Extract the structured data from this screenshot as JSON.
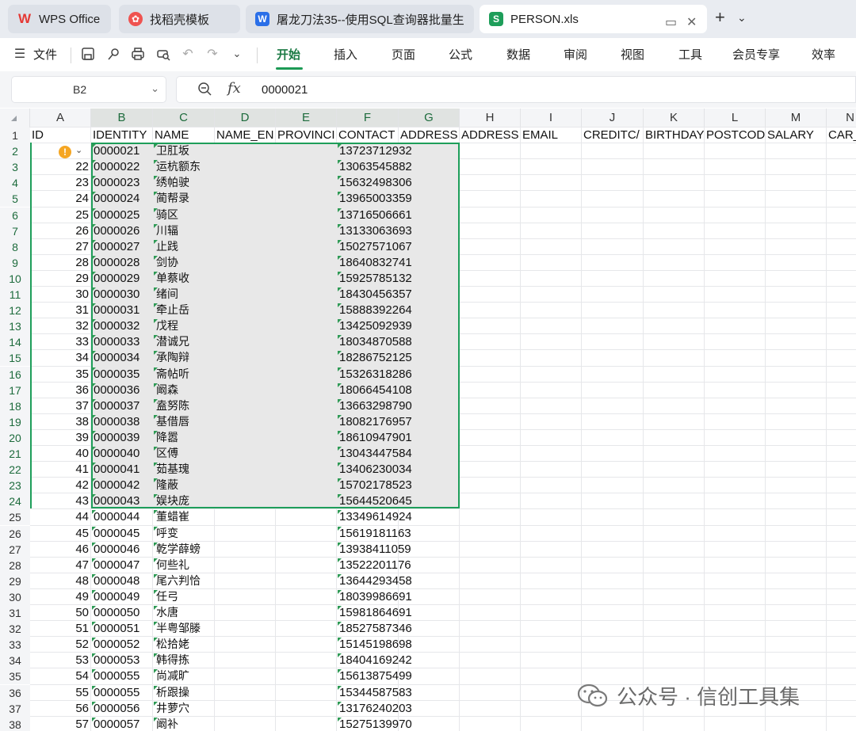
{
  "tabs": [
    {
      "title": "WPS Office",
      "icon": "wps-logo-icon",
      "icon_glyph": "W",
      "color": "#e53935"
    },
    {
      "title": "找稻壳模板",
      "icon": "docer-icon",
      "icon_glyph": "♨",
      "color": "#ef5350"
    },
    {
      "title": "屠龙刀法35--使用SQL查询器批量生",
      "icon": "word-doc-icon",
      "icon_glyph": "W",
      "color": "#2b6fe8"
    },
    {
      "title": "PERSON.xls",
      "icon": "spreadsheet-icon",
      "icon_glyph": "S",
      "color": "#1e9e5a"
    }
  ],
  "ribbon": {
    "file_menu": "文件",
    "menus": [
      "开始",
      "插入",
      "页面",
      "公式",
      "数据",
      "审阅",
      "视图",
      "工具",
      "会员专享",
      "效率"
    ],
    "active_menu": "开始",
    "quick_icons": [
      "save-icon",
      "format-painter-icon",
      "print-icon",
      "print-preview-icon",
      "undo-icon",
      "redo-icon",
      "more-dropdown-icon"
    ]
  },
  "formula_bar": {
    "name_box": "B2",
    "fx_label": "fx",
    "value": "0000021"
  },
  "columns": [
    "A",
    "B",
    "C",
    "D",
    "E",
    "F",
    "G",
    "H",
    "I",
    "J",
    "K",
    "L",
    "M",
    "N"
  ],
  "selected_columns": [
    "B",
    "C",
    "D",
    "E",
    "F",
    "G"
  ],
  "header_row": [
    "ID",
    "IDENTITY",
    "NAME",
    "NAME_EN",
    "PROVINCI",
    "CONTACT",
    "ADDRESS",
    "ADDRESS",
    "EMAIL",
    "CREDITC/",
    "BIRTHDAY",
    "POSTCOD",
    "SALARY",
    "CAR_"
  ],
  "rows": [
    {
      "row": "2",
      "id": "",
      "identity": "0000021",
      "name": "卫肛坂",
      "contact": "13723712932"
    },
    {
      "row": "3",
      "id": "22",
      "identity": "0000022",
      "name": "运杭额东",
      "contact": "13063545882"
    },
    {
      "row": "4",
      "id": "23",
      "identity": "0000023",
      "name": "绣帕驶",
      "contact": "15632498306"
    },
    {
      "row": "5",
      "id": "24",
      "identity": "0000024",
      "name": "蔺帮录",
      "contact": "13965003359"
    },
    {
      "row": "6",
      "id": "25",
      "identity": "0000025",
      "name": "骑区",
      "contact": "13716506661"
    },
    {
      "row": "7",
      "id": "26",
      "identity": "0000026",
      "name": "川辐",
      "contact": "13133063693"
    },
    {
      "row": "8",
      "id": "27",
      "identity": "0000027",
      "name": "止践",
      "contact": "15027571067"
    },
    {
      "row": "9",
      "id": "28",
      "identity": "0000028",
      "name": "剑协",
      "contact": "18640832741"
    },
    {
      "row": "10",
      "id": "29",
      "identity": "0000029",
      "name": "单蔡收",
      "contact": "15925785132"
    },
    {
      "row": "11",
      "id": "30",
      "identity": "0000030",
      "name": "绪间",
      "contact": "18430456357"
    },
    {
      "row": "12",
      "id": "31",
      "identity": "0000031",
      "name": "牵止岳",
      "contact": "15888392264"
    },
    {
      "row": "13",
      "id": "32",
      "identity": "0000032",
      "name": "戊程",
      "contact": "13425092939"
    },
    {
      "row": "14",
      "id": "33",
      "identity": "0000033",
      "name": "潜诚兄",
      "contact": "18034870588"
    },
    {
      "row": "15",
      "id": "34",
      "identity": "0000034",
      "name": "承陶辩",
      "contact": "18286752125"
    },
    {
      "row": "16",
      "id": "35",
      "identity": "0000035",
      "name": "斋帖听",
      "contact": "15326318286"
    },
    {
      "row": "17",
      "id": "36",
      "identity": "0000036",
      "name": "阚森",
      "contact": "18066454108"
    },
    {
      "row": "18",
      "id": "37",
      "identity": "0000037",
      "name": "盍努陈",
      "contact": "13663298790"
    },
    {
      "row": "19",
      "id": "38",
      "identity": "0000038",
      "name": "基借唇",
      "contact": "18082176957"
    },
    {
      "row": "20",
      "id": "39",
      "identity": "0000039",
      "name": "降嚣",
      "contact": "18610947901"
    },
    {
      "row": "21",
      "id": "40",
      "identity": "0000040",
      "name": "区傅",
      "contact": "13043447584"
    },
    {
      "row": "22",
      "id": "41",
      "identity": "0000041",
      "name": "茹基瑰",
      "contact": "13406230034"
    },
    {
      "row": "23",
      "id": "42",
      "identity": "0000042",
      "name": "隆蔽",
      "contact": "15702178523"
    },
    {
      "row": "24",
      "id": "43",
      "identity": "0000043",
      "name": "娱块庞",
      "contact": "15644520645"
    },
    {
      "row": "25",
      "id": "44",
      "identity": "0000044",
      "name": "董蜡崔",
      "contact": "13349614924"
    },
    {
      "row": "26",
      "id": "45",
      "identity": "0000045",
      "name": "呼变",
      "contact": "15619181163"
    },
    {
      "row": "27",
      "id": "46",
      "identity": "0000046",
      "name": "乾学薛螃",
      "contact": "13938411059"
    },
    {
      "row": "28",
      "id": "47",
      "identity": "0000047",
      "name": "何些礼",
      "contact": "13522201176"
    },
    {
      "row": "29",
      "id": "48",
      "identity": "0000048",
      "name": "尾六判恰",
      "contact": "13644293458"
    },
    {
      "row": "30",
      "id": "49",
      "identity": "0000049",
      "name": "任弓",
      "contact": "18039986691"
    },
    {
      "row": "31",
      "id": "50",
      "identity": "0000050",
      "name": "水唐",
      "contact": "15981864691"
    },
    {
      "row": "32",
      "id": "51",
      "identity": "0000051",
      "name": "半粤邹滕",
      "contact": "18527587346"
    },
    {
      "row": "33",
      "id": "52",
      "identity": "0000052",
      "name": "松拾姥",
      "contact": "15145198698"
    },
    {
      "row": "34",
      "id": "53",
      "identity": "0000053",
      "name": "韩得拣",
      "contact": "18404169242"
    },
    {
      "row": "35",
      "id": "54",
      "identity": "0000055",
      "name": "尚减旷",
      "contact": "15613875499"
    },
    {
      "row": "36",
      "id": "55",
      "identity": "0000055",
      "name": "析跟操",
      "contact": "15344587583"
    },
    {
      "row": "37",
      "id": "56",
      "identity": "0000056",
      "name": "井萝穴",
      "contact": "13176240203"
    },
    {
      "row": "38",
      "id": "57",
      "identity": "0000057",
      "name": "阚补",
      "contact": "15275139970"
    }
  ],
  "watermark": "公众号 · 信创工具集",
  "colors": {
    "accent": "#1e9e5a",
    "selection_fill": "#e8e8e8",
    "warning": "#f5a623"
  }
}
